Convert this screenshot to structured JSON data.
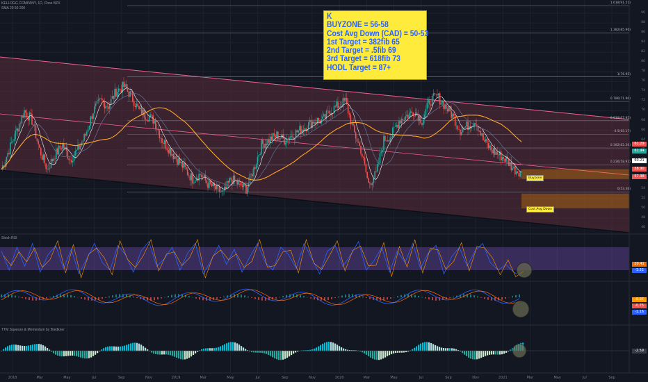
{
  "header": {
    "symbol_line": "KELLOGG COMPANY, 1D, Cboe BZX",
    "sub_line": "SMA 20 50 200",
    "rsi_title": "Stoch RSI",
    "ttm_title": "TTM Squeeze & Momentum by Bredkner"
  },
  "note": {
    "lines": [
      "K",
      "BUYZONE = 56-58",
      "Cost Avg Down (CAD) = 50-53",
      "1st Target = 382fib 65",
      "2nd Target = .5fib 69",
      "3rd Target = 618fib 73",
      "HODL Target = 87+"
    ]
  },
  "zones": {
    "buyzone_label": "Buyzone",
    "cad_label": "Cost Avg Down"
  },
  "colors": {
    "background": "#131722",
    "channel_fill": "#5b2c3a",
    "channel_line": "#f06292",
    "up": "#26a69a",
    "down": "#ef5350",
    "zone_fill": "#ff9800",
    "note_bg": "#ffeb3b",
    "note_text": "#2962ff",
    "rsi_band": "#7e57c2"
  },
  "chart_data": {
    "type": "line",
    "title": "KELLOGG COMPANY, 1D",
    "x_ticks": [
      "2018",
      "Mar",
      "May",
      "Jul",
      "Sep",
      "Nov",
      "2019",
      "Mar",
      "May",
      "Jul",
      "Sep",
      "Nov",
      "2020",
      "Mar",
      "May",
      "Jul",
      "Sep",
      "Nov",
      "2021",
      "Mar",
      "May",
      "Jul",
      "Sep"
    ],
    "y_ticks": [
      46,
      48,
      50,
      52,
      54,
      56,
      58,
      60,
      62,
      64,
      66,
      68,
      70,
      72,
      74,
      76,
      78,
      80,
      82,
      84,
      86,
      88,
      90
    ],
    "ylim": [
      45,
      92
    ],
    "price_labels": [
      {
        "value": "61.29",
        "color": "#ef5350"
      },
      {
        "value": "61.94",
        "color": "#26a69a"
      },
      {
        "value": "60.21",
        "color": "#ffffff"
      },
      {
        "value": "58.90",
        "color": "#ef5350"
      },
      {
        "value": "57.38",
        "color": "#ef5350"
      }
    ],
    "fib_levels": [
      {
        "label": "1.618(91.51)",
        "value": 91.51
      },
      {
        "label": "1.382(85.96)",
        "value": 85.96
      },
      {
        "label": "1(76.95)",
        "value": 76.95
      },
      {
        "label": "0.786(71.90)",
        "value": 71.9
      },
      {
        "label": "0.618(67.95)",
        "value": 67.95
      },
      {
        "label": "0.5(65.17)",
        "value": 65.17
      },
      {
        "label": "0.382(62.36)",
        "value": 62.36
      },
      {
        "label": "0.236(58.91)",
        "value": 58.91
      },
      {
        "label": "0(53.36)",
        "value": 53.36
      }
    ],
    "buyzone": [
      56,
      58
    ],
    "cad_zone": [
      50,
      53
    ],
    "price_series": [
      58,
      62,
      66,
      70,
      68,
      62,
      58,
      61,
      63,
      60,
      62,
      65,
      70,
      72,
      71,
      74,
      75,
      73,
      70,
      69,
      68,
      64,
      62,
      60,
      58,
      56,
      57,
      55,
      54,
      53,
      56,
      55,
      54,
      58,
      63,
      64,
      65,
      64,
      65,
      66,
      67,
      68,
      68,
      70,
      71,
      72,
      66,
      62,
      55,
      57,
      64,
      65,
      68,
      69,
      70,
      68,
      72,
      73,
      71,
      69,
      66,
      67,
      68,
      64,
      62,
      61,
      60,
      58,
      57.4
    ],
    "rsi": {
      "ylim": [
        0,
        100
      ],
      "values": [
        70,
        20,
        80,
        30,
        90,
        15,
        60,
        85,
        25,
        75,
        10,
        50,
        90,
        40,
        20,
        85,
        60,
        15,
        70,
        95,
        30,
        50,
        80,
        20,
        65,
        90,
        10,
        45,
        85,
        35,
        75,
        15,
        55,
        90,
        40,
        20,
        80,
        60,
        25,
        90,
        50,
        10,
        70,
        85,
        30,
        60,
        95,
        20,
        45,
        80,
        15,
        70,
        40,
        90,
        25,
        65,
        85,
        10,
        55,
        80,
        30,
        70,
        90,
        40,
        20,
        35,
        15,
        5
      ],
      "labels": [
        {
          "value": "20.41",
          "color": "#ef6c00"
        },
        {
          "value": "-3.52",
          "color": "#2962ff"
        }
      ]
    },
    "macd": {
      "labels": [
        {
          "value": "-0.07",
          "color": "#ff9800"
        },
        {
          "value": "-0.75",
          "color": "#ef5350"
        },
        {
          "value": "-1.16",
          "color": "#2962ff"
        }
      ]
    },
    "ttm": {
      "labels": [
        {
          "value": "-2.59",
          "color": "#ffffff"
        }
      ]
    }
  }
}
